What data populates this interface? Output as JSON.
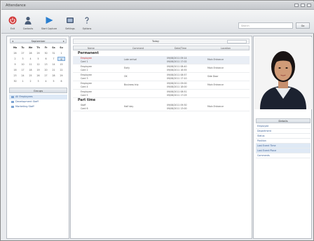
{
  "window": {
    "title": "Attendance"
  },
  "toolbar": {
    "buttons": [
      {
        "label": "Exit",
        "icon": "power-icon",
        "color": "#d23b3b"
      },
      {
        "label": "Contacts",
        "icon": "person-icon",
        "color": "#4a5d78"
      },
      {
        "label": "Start Capture",
        "icon": "play-icon",
        "color": "#2a7fd0"
      },
      {
        "label": "Settings",
        "icon": "gear-icon",
        "color": "#4a5d78"
      },
      {
        "label": "Options",
        "icon": "help-icon",
        "color": "#4a5d78"
      }
    ],
    "search_placeholder": "Search",
    "search_button": "Go"
  },
  "calendar": {
    "month_label": "September",
    "day_headers": [
      "Mo",
      "Tu",
      "We",
      "Th",
      "Fr",
      "Sa",
      "Su"
    ],
    "weeks": [
      [
        "26",
        "27",
        "28",
        "29",
        "30",
        "31",
        "1"
      ],
      [
        "2",
        "3",
        "4",
        "5",
        "6",
        "7",
        "8"
      ],
      [
        "9",
        "10",
        "11",
        "12",
        "13",
        "14",
        "15"
      ],
      [
        "16",
        "17",
        "18",
        "19",
        "20",
        "21",
        "22"
      ],
      [
        "23",
        "24",
        "25",
        "26",
        "27",
        "28",
        "29"
      ],
      [
        "30",
        "1",
        "2",
        "3",
        "4",
        "5",
        "6"
      ]
    ]
  },
  "groups": {
    "header": "Groups",
    "items": [
      {
        "label": "All Employees"
      },
      {
        "label": "Development Staff"
      },
      {
        "label": "Marketing Staff"
      }
    ]
  },
  "center": {
    "topbar_label": "Today",
    "columns": [
      "Name",
      "Comment",
      "Date/Time",
      "Location"
    ],
    "groups": [
      {
        "name": "Permanent",
        "rows": [
          {
            "name1": "Employee",
            "name2": "Card 1",
            "comment": "Late arrival",
            "date1": "09/08/2011 09:14",
            "date2": "09/08/2011 17:02",
            "location": "Main Entrance"
          },
          {
            "name1": "Employee",
            "name2": "Card 2",
            "comment": "Early",
            "date1": "09/08/2011 08:40",
            "date2": "09/08/2011 16:55",
            "location": "Main Entrance"
          },
          {
            "name1": "Employee",
            "name2": "Card 3",
            "comment": "OK",
            "date1": "09/08/2011 08:57",
            "date2": "09/08/2011 17:10",
            "location": "Side Door"
          },
          {
            "name1": "Employee",
            "name2": "Card 4",
            "comment": "Business trip",
            "date1": "09/08/2011 09:00",
            "date2": "09/08/2011 18:00",
            "location": "Main Entrance"
          },
          {
            "name1": "Employee",
            "name2": "Card 5",
            "comment": "",
            "date1": "09/08/2011 08:51",
            "date2": "09/08/2011 17:03",
            "location": ""
          }
        ]
      },
      {
        "name": "Part time",
        "rows": [
          {
            "name1": "Staff",
            "name2": "Card 6",
            "comment": "Half day",
            "date1": "09/08/2011 09:30",
            "date2": "09/08/2011 13:00",
            "location": "Main Entrance"
          }
        ]
      }
    ]
  },
  "right": {
    "photo_label": "employee-portrait",
    "props_header": "Details",
    "props": [
      {
        "label": "Employee",
        "value": ""
      },
      {
        "label": "Department",
        "value": ""
      },
      {
        "label": "Status",
        "value": ""
      },
      {
        "label": "Position",
        "value": ""
      },
      {
        "label": "Last Event Time",
        "value": ""
      },
      {
        "label": "Last Event Place",
        "value": ""
      },
      {
        "label": "Comments",
        "value": ""
      }
    ]
  }
}
